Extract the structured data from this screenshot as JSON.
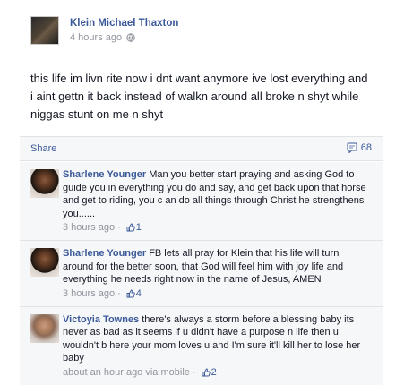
{
  "post": {
    "author": "Klein Michael Thaxton",
    "timestamp": "4 hours ago",
    "text": "this life im livn rite now i dnt want anymore ive lost everything and i aint gettn it back instead of walkn around all broke n shyt while niggas stunt on me n shyt",
    "share_label": "Share",
    "comment_count": "68",
    "icons": {
      "privacy": "globe-icon",
      "comments": "comment-icon",
      "like": "like-icon"
    }
  },
  "comments": [
    {
      "name": "Sharlene Younger",
      "text": "Man you better start praying and asking God to guide you in everything you do and say, and get back upon that horse and get to riding, you c an do all things through Christ he strengthens you......",
      "time": "3 hours ago",
      "likes": "1"
    },
    {
      "name": "Sharlene Younger",
      "text": "FB lets all pray for Klein that his life will turn around for the better soon, that God will feel him with joy life and everything he needs right now in the name of Jesus, AMEN",
      "time": "3 hours ago",
      "likes": "4"
    },
    {
      "name": "Victoyia Townes",
      "text": "there's always a storm before a blessing baby its never as bad as it seems if u didn't have a purpose n life then u wouldn't b here your mom loves u and I'm sure it'll kill her to lose her baby",
      "time": "about an hour ago via mobile",
      "likes": "2"
    }
  ]
}
